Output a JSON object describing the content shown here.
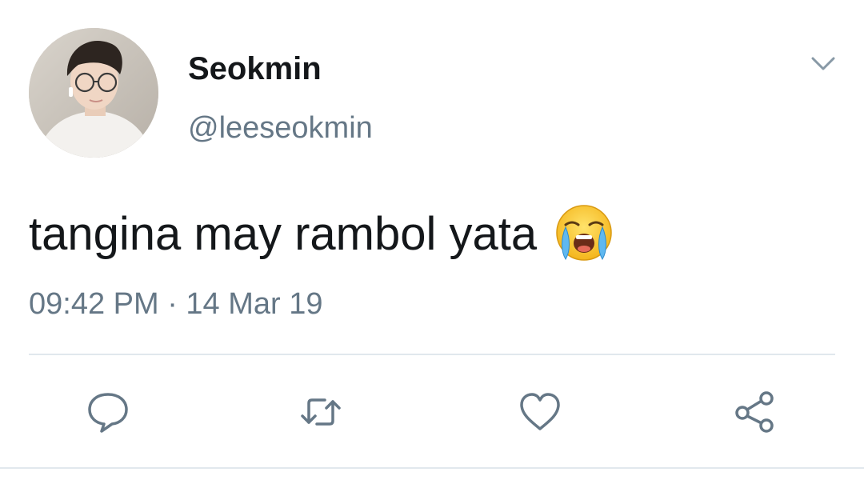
{
  "tweet": {
    "author": {
      "display_name": "Seokmin",
      "handle": "@leeseokmin",
      "avatar": "profile-photo"
    },
    "text": "tangina may rambol yata",
    "emoji": "loudly-crying-face-emoji",
    "timestamp": "09:42 PM · 14 Mar 19"
  },
  "actions": [
    {
      "name": "reply",
      "icon": "comment-bubble-icon"
    },
    {
      "name": "retweet",
      "icon": "retweet-arrows-icon"
    },
    {
      "name": "like",
      "icon": "heart-icon"
    },
    {
      "name": "share",
      "icon": "share-nodes-icon"
    }
  ],
  "menu": {
    "icon": "chevron-down-icon"
  },
  "colors": {
    "text": "#14171a",
    "secondary": "#657786",
    "divider": "#e1e8ed",
    "icon": "#657786"
  }
}
